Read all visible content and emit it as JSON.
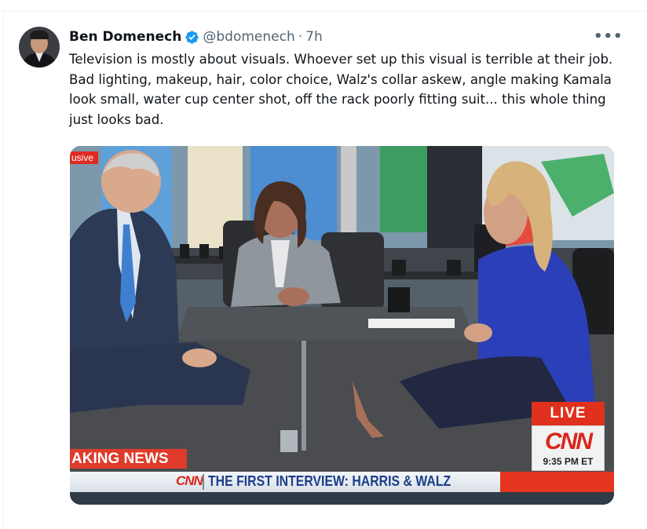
{
  "tweet": {
    "author_name": "Ben Domenech",
    "handle": "@bdomenech",
    "separator": "·",
    "time": "7h",
    "more_label": "•••",
    "text": "Television is mostly about visuals. Whoever set up this visual is terrible at their job. Bad lighting, makeup, hair, color choice, Walz's collar askew, angle making Kamala look small, water cup center shot, off the rack poorly fitting suit... this whole thing just looks bad."
  },
  "media": {
    "exclusive_tag": "usive",
    "breaking_label": "AKING NEWS",
    "network_small": "CNN",
    "headline": "THE FIRST INTERVIEW: HARRIS & WALZ",
    "live_label": "LIVE",
    "network_logo": "CNN",
    "clock": "9:35 PM ET"
  },
  "colors": {
    "verified": "#1d9bf0",
    "cnn_red": "#d8261c",
    "headline_blue": "#1c3e8a"
  },
  "icons": {
    "verified": "verified-badge-icon",
    "more": "more-options-icon"
  }
}
